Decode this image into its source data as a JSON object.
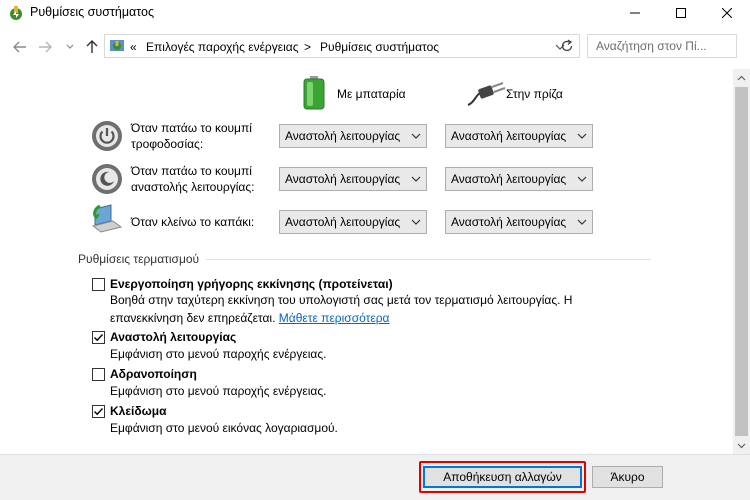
{
  "window": {
    "title": "Ρυθμίσεις συστήματος"
  },
  "address": {
    "overflow": "«",
    "crumbs": [
      "Επιλογές παροχής ενέργειας",
      "Ρυθμίσεις συστήματος"
    ],
    "separator": ">"
  },
  "search": {
    "placeholder": "Αναζήτηση στον Πί..."
  },
  "columns": {
    "battery": "Με μπαταρία",
    "plugged": "Στην πρίζα"
  },
  "power_rows": [
    {
      "label": "Όταν πατάω το κουμπί\nτροφοδοσίας:",
      "battery": "Αναστολή λειτουργίας",
      "plugged": "Αναστολή λειτουργίας"
    },
    {
      "label": "Όταν πατάω το κουμπί\nαναστολής λειτουργίας:",
      "battery": "Αναστολή λειτουργίας",
      "plugged": "Αναστολή λειτουργίας"
    },
    {
      "label": "Όταν κλείνω το καπάκι:",
      "battery": "Αναστολή λειτουργίας",
      "plugged": "Αναστολή λειτουργίας"
    }
  ],
  "shutdown": {
    "section_label": "Ρυθμίσεις τερματισμού",
    "options": [
      {
        "title": "Ενεργοποίηση γρήγορης εκκίνησης (προτείνεται)",
        "desc": "Βοηθά στην ταχύτερη εκκίνηση του υπολογιστή σας μετά τον τερματισμό λειτουργίας. Η",
        "desc2": "επανεκκίνηση δεν επηρεάζεται.",
        "link": "Μάθετε περισσότερα",
        "checked": false
      },
      {
        "title": "Αναστολή λειτουργίας",
        "desc": "Εμφάνιση στο μενού παροχής ενέργειας.",
        "checked": true
      },
      {
        "title": "Αδρανοποίηση",
        "desc": "Εμφάνιση στο μενού παροχής ενέργειας.",
        "checked": false
      },
      {
        "title": "Κλείδωμα",
        "desc": "Εμφάνιση στο μενού εικόνας λογαριασμού.",
        "checked": true
      }
    ]
  },
  "footer": {
    "save": "Αποθήκευση αλλαγών",
    "cancel": "Άκυρο"
  },
  "colors": {
    "accent": "#0078d7",
    "highlight": "#e00000",
    "link": "#0066cc"
  },
  "icons": [
    "power-options-icon",
    "back-arrow-icon",
    "forward-arrow-icon",
    "recent-dropdown-icon",
    "up-arrow-icon",
    "refresh-icon",
    "search-icon",
    "battery-icon",
    "plug-icon",
    "power-button-icon",
    "sleep-button-icon",
    "laptop-lid-icon"
  ]
}
